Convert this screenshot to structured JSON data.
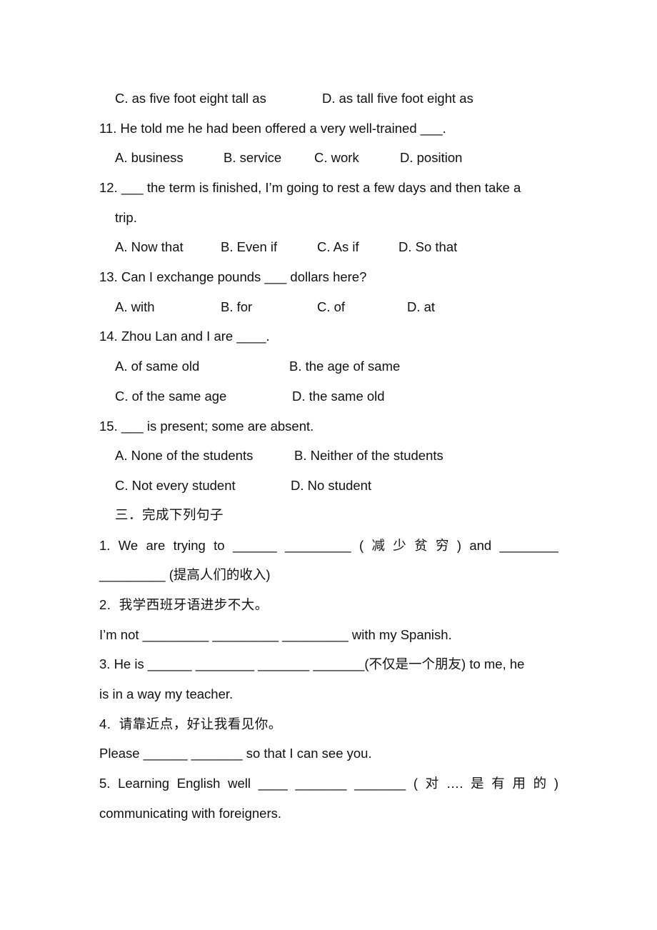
{
  "document": {
    "q10_options": {
      "C": "C. as five foot eight tall as",
      "D": "D. as tall five foot eight as"
    },
    "questions": [
      {
        "stem": "11. He told me he had been offered a very well-trained ___.",
        "options": [
          "A. business",
          "B. service",
          "C. work",
          "D. position"
        ]
      },
      {
        "stem": "12. ___ the term is finished, I’m going to rest a few days and then take a",
        "stem_cont": "trip.",
        "options": [
          "A. Now that",
          "B. Even if",
          "C. As if",
          "D. So that"
        ]
      },
      {
        "stem": "13. Can I exchange pounds ___ dollars here?",
        "options": [
          "A. with",
          "B. for",
          "C. of",
          "D. at"
        ]
      },
      {
        "stem": "14. Zhou Lan and I are ____.",
        "options": [
          "A. of same old",
          "B. the age of same",
          "C. of the same age",
          "D. the same old"
        ]
      },
      {
        "stem": "15. ___ is present; some are absent.",
        "options": [
          "A. None of the students",
          "B. Neither of the students",
          "C. Not every student",
          "D. No student"
        ]
      }
    ],
    "section3": {
      "heading": "三．完成下列句子",
      "items": [
        {
          "line1_parts": [
            "1.",
            "We",
            "are",
            "trying",
            "to",
            "______",
            "_________",
            "(",
            "减",
            "少",
            "贫",
            "穷",
            ")",
            "and",
            "________"
          ],
          "line2": "_________ (提高人们的收入)"
        },
        {
          "line1": "2.  我学西班牙语进步不大。",
          "line2": "I’m not _________ _________ _________ with my Spanish."
        },
        {
          "line1": "3. He is ______ ________ _______ _______(不仅是一个朋友) to me, he",
          "line2": "is in a way my teacher."
        },
        {
          "line1": "4.  请靠近点，好让我看见你。",
          "line2": "Please ______ _______ so that I can see you."
        },
        {
          "line1_parts": [
            "5.",
            "Learning",
            "English",
            "well",
            "____",
            "_______",
            "_______",
            "(",
            "对",
            "….",
            "是",
            "有",
            "用",
            "的",
            ")"
          ],
          "line2": "communicating with foreigners."
        }
      ]
    }
  }
}
